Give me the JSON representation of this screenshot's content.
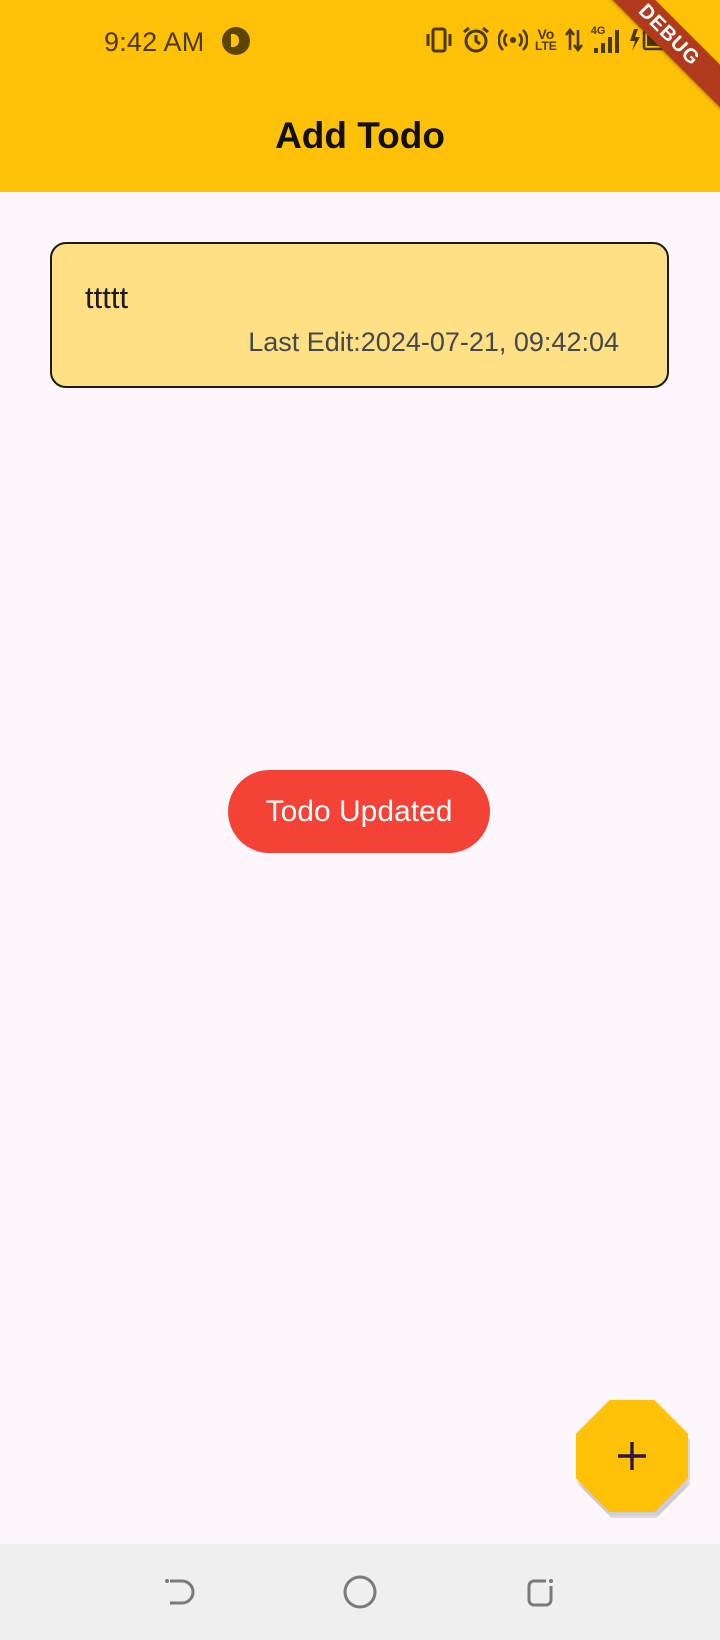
{
  "status_bar": {
    "time": "9:42 AM",
    "volte_label_top": "Vo",
    "volte_label_bottom": "LTE",
    "network_label": "4G"
  },
  "debug_banner": "DEBUG",
  "app_bar": {
    "title": "Add Todo"
  },
  "todos": [
    {
      "title": "ttttt",
      "last_edit": "Last Edit:2024-07-21, 09:42:04"
    }
  ],
  "toast": {
    "message": "Todo Updated"
  },
  "fab": {
    "icon": "plus-icon"
  },
  "colors": {
    "app_bar": "#FFC107",
    "background": "#FDF7FD",
    "card": "#FFE085",
    "toast": "#F44336",
    "fab": "#FFC107",
    "nav_bar": "#EFEFEF"
  }
}
